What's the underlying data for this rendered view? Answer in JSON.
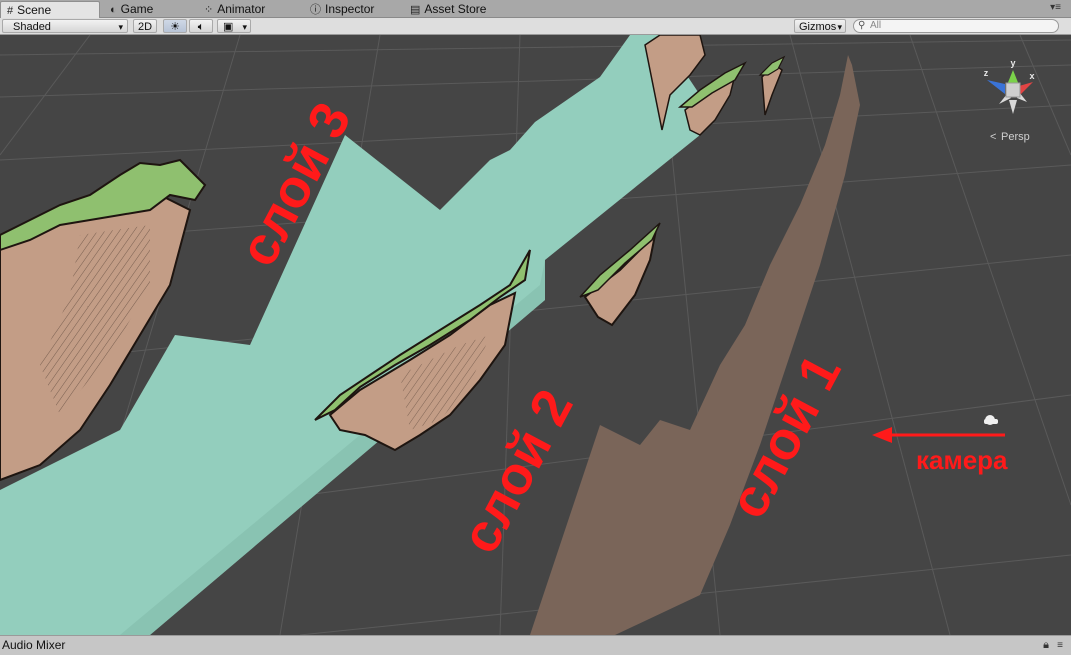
{
  "tabs": [
    {
      "label": "Scene",
      "icon": "grid-icon"
    },
    {
      "label": "Game",
      "icon": "game-icon"
    },
    {
      "label": "Animator",
      "icon": "animator-icon"
    },
    {
      "label": "Inspector",
      "icon": "info-icon"
    },
    {
      "label": "Asset Store",
      "icon": "store-icon"
    }
  ],
  "toolbar": {
    "draw_mode": "Shaded",
    "mode_2d": "2D",
    "gizmos": "Gizmos",
    "search_placeholder": "All"
  },
  "scene": {
    "layer3_label": "слой 3",
    "layer2_label": "слой 2",
    "layer1_label": "слой 1",
    "camera_label": "камера",
    "projection_label": "Persp",
    "gizmo_axes": {
      "y": "y",
      "x": "x",
      "z": "z"
    },
    "colors": {
      "background": "#454545",
      "layer3_fill": "#93cebd",
      "layer1_fill": "#7a6559",
      "rock": "#c39d86",
      "grass": "#8fc06f",
      "annotation": "#ff1a1a"
    }
  },
  "statusbar": {
    "label": "Audio Mixer"
  }
}
